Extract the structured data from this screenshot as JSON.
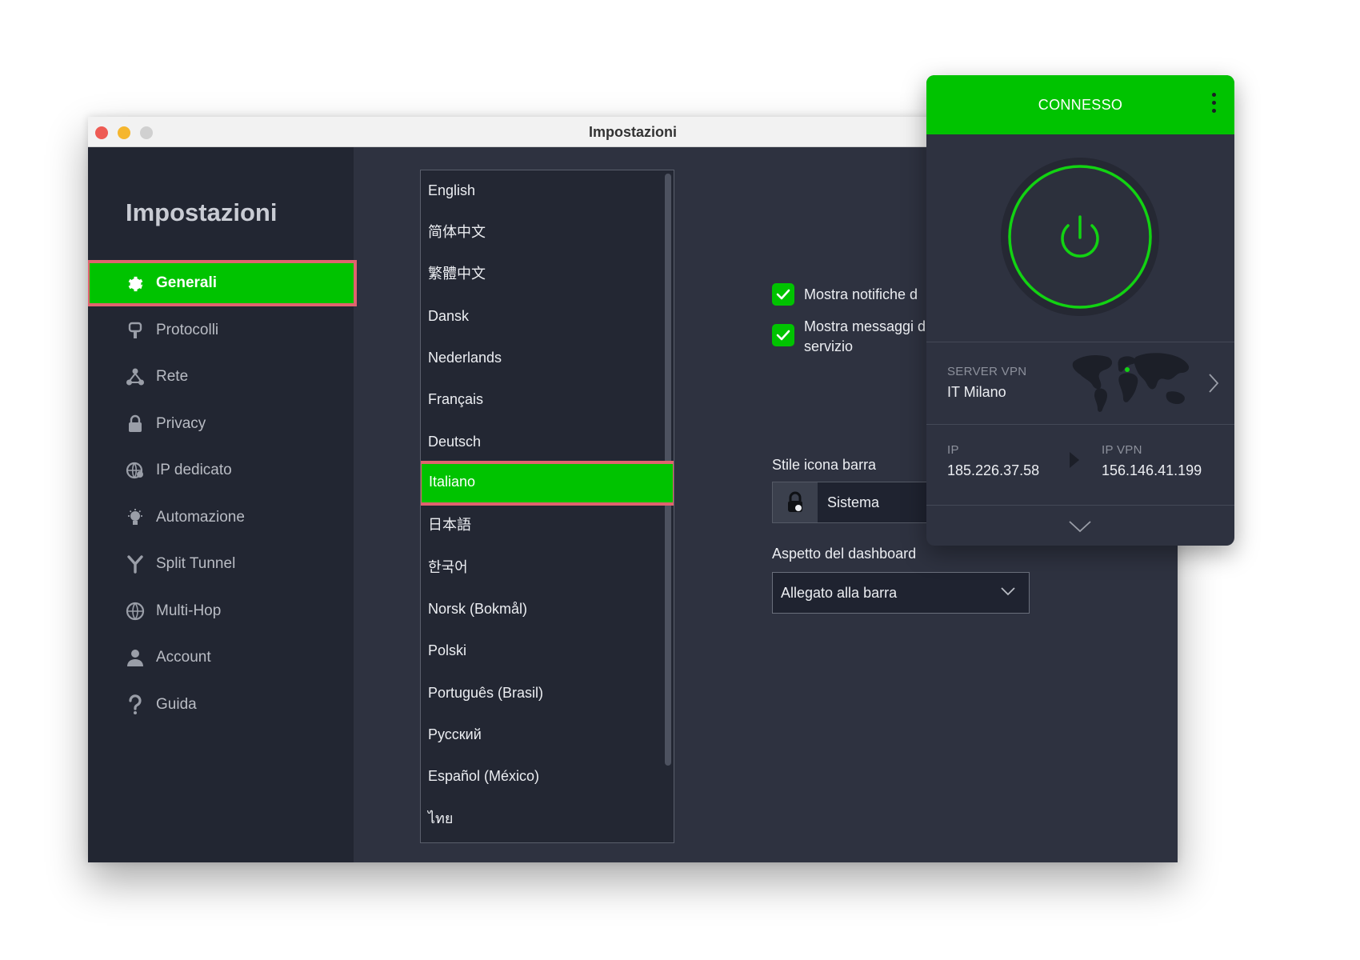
{
  "window": {
    "title": "Impostazioni"
  },
  "sidebar": {
    "title": "Impostazioni",
    "items": [
      {
        "label": "Generali",
        "icon": "gear-icon",
        "active": true
      },
      {
        "label": "Protocolli",
        "icon": "protocol-icon"
      },
      {
        "label": "Rete",
        "icon": "network-icon"
      },
      {
        "label": "Privacy",
        "icon": "lock-icon"
      },
      {
        "label": "IP dedicato",
        "icon": "globe-pin-icon"
      },
      {
        "label": "Automazione",
        "icon": "bulb-icon"
      },
      {
        "label": "Split Tunnel",
        "icon": "split-icon"
      },
      {
        "label": "Multi-Hop",
        "icon": "globe-icon"
      },
      {
        "label": "Account",
        "icon": "user-icon"
      },
      {
        "label": "Guida",
        "icon": "question-icon"
      }
    ]
  },
  "languages": {
    "items": [
      "English",
      "简体中文",
      "繁體中文",
      "Dansk",
      "Nederlands",
      "Français",
      "Deutsch",
      "Italiano",
      "日本語",
      "한국어",
      "Norsk (Bokmål)",
      "Polski",
      "Português (Brasil)",
      "Русский",
      "Español (México)",
      "ไทย"
    ],
    "selected": "Italiano"
  },
  "options": {
    "show_notifications": {
      "label": "Mostra notifiche d",
      "checked": true
    },
    "show_service_messages": {
      "label_line1": "Mostra messaggi d",
      "label_line2": "servizio",
      "checked": true
    }
  },
  "tray_icon_style": {
    "label": "Stile icona barra",
    "value": "Sistema"
  },
  "dashboard_appearance": {
    "label": "Aspetto del dashboard",
    "value": "Allegato alla barra"
  },
  "vpn": {
    "status": "CONNESSO",
    "server_caption": "SERVER VPN",
    "server_value": "IT Milano",
    "ip_caption": "IP",
    "ip_value": "185.226.37.58",
    "vpn_ip_caption": "IP VPN",
    "vpn_ip_value": "156.146.41.199"
  },
  "colors": {
    "accent_green": "#00c300",
    "highlight_border": "#e0636e",
    "sidebar_bg": "#222632",
    "content_bg": "#2e3240"
  }
}
